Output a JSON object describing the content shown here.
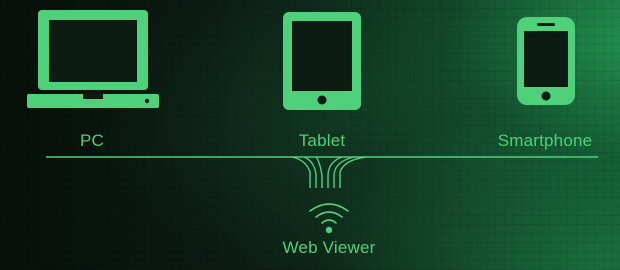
{
  "devices": [
    {
      "label": "PC",
      "icon": "laptop-icon"
    },
    {
      "label": "Tablet",
      "icon": "tablet-icon"
    },
    {
      "label": "Smartphone",
      "icon": "smartphone-icon"
    }
  ],
  "hub": {
    "label": "Web Viewer",
    "icon": "wifi-icon"
  },
  "colors": {
    "accent": "#4fd07a",
    "background_dark": "#0a1410",
    "background_glow": "#13492a"
  }
}
